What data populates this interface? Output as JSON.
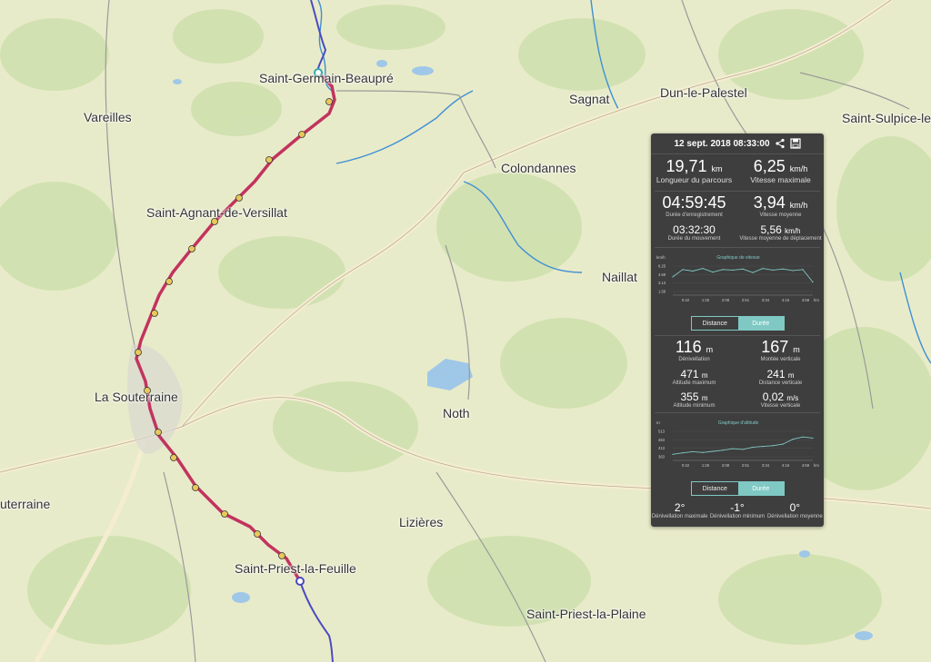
{
  "map": {
    "places": [
      {
        "id": "saint-germain-beaupre",
        "label": "Saint-Germain-Beaupré"
      },
      {
        "id": "vareilles",
        "label": "Vareilles"
      },
      {
        "id": "sagnat",
        "label": "Sagnat"
      },
      {
        "id": "dun-le-palestel",
        "label": "Dun-le-Palestel"
      },
      {
        "id": "saint-sulpice",
        "label": "Saint-Sulpice-le"
      },
      {
        "id": "colondannes",
        "label": "Colondannes"
      },
      {
        "id": "saint-agnant",
        "label": "Saint-Agnant-de-Versillat"
      },
      {
        "id": "naillat",
        "label": "Naillat"
      },
      {
        "id": "la-souterraine",
        "label": "La Souterraine"
      },
      {
        "id": "noth",
        "label": "Noth"
      },
      {
        "id": "souterraine-edge",
        "label": "uterraine"
      },
      {
        "id": "lizieres",
        "label": "Lizières"
      },
      {
        "id": "saint-priest-la-feuille",
        "label": "Saint-Priest-la-Feuille"
      },
      {
        "id": "saint-priest-la-plaine",
        "label": "Saint-Priest-la-Plaine"
      }
    ],
    "colors": {
      "track": "#c2335f",
      "route": "#4b4bbf",
      "water": "#9fc7e8",
      "road": "#f3ead0",
      "forest": "#c9deaa"
    }
  },
  "panel": {
    "date": "12 sept. 2018 08:33:00",
    "share_icon": "share-icon",
    "save_icon": "save-icon",
    "distance": {
      "value": "19,71",
      "unit": "km",
      "label": "Longueur du parcours"
    },
    "max_speed": {
      "value": "6,25",
      "unit": "km/h",
      "label": "Vitesse maximale"
    },
    "rec_duration": {
      "value": "04:59:45",
      "label": "Durée d'enregistrement"
    },
    "avg_speed": {
      "value": "3,94",
      "unit": "km/h",
      "label": "Vitesse moyenne"
    },
    "move_duration": {
      "value": "03:32:30",
      "label": "Durée du mouvement"
    },
    "avg_move_speed": {
      "value": "5,56",
      "unit": "km/h",
      "label": "Vitesse moyenne de déplacement"
    },
    "speed_chart": {
      "title": "Graphique de vitesse",
      "unit": "km/h",
      "yticks": [
        "6.25",
        "4.69",
        "3.13",
        "1.56"
      ],
      "xticks": [
        "0:42",
        "1:25",
        "2:08",
        "2:51",
        "3:34",
        "4:16",
        "4:59"
      ],
      "xunit": "hm"
    },
    "toggle1": {
      "distance": "Distance",
      "duration": "Durée"
    },
    "elev_gain": {
      "value": "116",
      "unit": "m",
      "label": "Dénivellation"
    },
    "climb": {
      "value": "167",
      "unit": "m",
      "label": "Montée verticale"
    },
    "max_alt": {
      "value": "471",
      "unit": "m",
      "label": "Altitude maximum"
    },
    "vert_dist": {
      "value": "241",
      "unit": "m",
      "label": "Distance verticale"
    },
    "min_alt": {
      "value": "355",
      "unit": "m",
      "label": "Altitude minimum"
    },
    "vert_speed": {
      "value": "0,02",
      "unit": "m/s",
      "label": "Vitesse verticale"
    },
    "alt_chart": {
      "title": "Graphique d'altitude",
      "unit": "m",
      "yticks": [
        "513",
        "463",
        "413",
        "363"
      ],
      "xticks": [
        "0:42",
        "1:25",
        "2:08",
        "2:51",
        "3:34",
        "4:16",
        "4:59"
      ],
      "xunit": "hm"
    },
    "toggle2": {
      "distance": "Distance",
      "duration": "Durée"
    },
    "grade_max": {
      "value": "2°",
      "label": "Dénivellation maximale"
    },
    "grade_min": {
      "value": "-1°",
      "label": "Dénivellation minimum"
    },
    "grade_avg": {
      "value": "0°",
      "label": "Dénivellation moyenne"
    }
  },
  "chart_data": [
    {
      "type": "line",
      "title": "Graphique de vitesse",
      "ylabel": "km/h",
      "xlabel": "hm",
      "x": [
        "0:00",
        "0:21",
        "0:42",
        "1:03",
        "1:25",
        "1:46",
        "2:08",
        "2:29",
        "2:51",
        "3:12",
        "3:34",
        "3:55",
        "4:16",
        "4:37",
        "4:59"
      ],
      "y": [
        3.5,
        4.9,
        4.6,
        5.1,
        4.4,
        4.9,
        4.8,
        5.0,
        4.3,
        5.1,
        4.8,
        5.0,
        4.7,
        4.9,
        2.5
      ],
      "ylim": [
        0,
        6.25
      ]
    },
    {
      "type": "line",
      "title": "Graphique d'altitude",
      "ylabel": "m",
      "xlabel": "hm",
      "x": [
        "0:00",
        "0:21",
        "0:42",
        "1:03",
        "1:25",
        "1:46",
        "2:08",
        "2:29",
        "2:51",
        "3:12",
        "3:34",
        "3:55",
        "4:16",
        "4:37",
        "4:59"
      ],
      "y": [
        372,
        380,
        386,
        382,
        388,
        394,
        402,
        398,
        410,
        414,
        418,
        426,
        452,
        464,
        458
      ],
      "ylim": [
        340,
        513
      ]
    }
  ]
}
